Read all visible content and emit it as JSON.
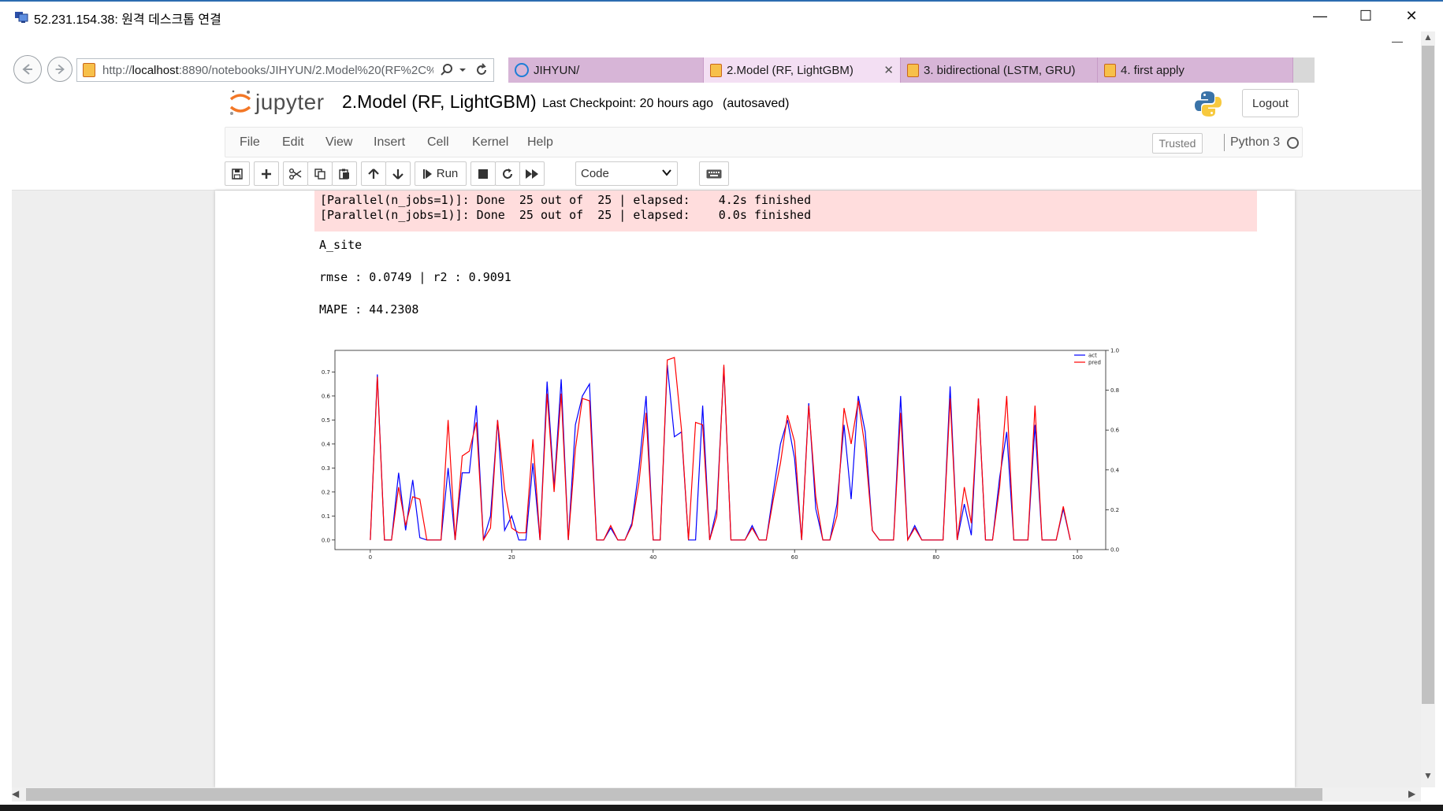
{
  "window": {
    "title": "52.231.154.38: 원격 데스크톱 연결",
    "minimize": "—",
    "maximize": "☐",
    "close": "✕"
  },
  "browser": {
    "url_prefix": "http://",
    "url_host": "localhost",
    "url_rest": ":8890/notebooks/JIHYUN/2.Model%20(RF%2C%",
    "tabs": [
      {
        "label": "JIHYUN/"
      },
      {
        "label": "2.Model (RF, LightGBM)"
      },
      {
        "label": "3. bidirectional (LSTM, GRU)"
      },
      {
        "label": "4. first apply"
      }
    ],
    "tab_close": "✕"
  },
  "jupyter": {
    "logo_text": "jupyter",
    "notebook_title": "2.Model (RF, LightGBM)",
    "checkpoint": "Last Checkpoint: 20 hours ago",
    "autosaved": "(autosaved)",
    "logout": "Logout",
    "menu": [
      "File",
      "Edit",
      "View",
      "Insert",
      "Cell",
      "Kernel",
      "Help"
    ],
    "trusted": "Trusted",
    "kernel": "Python 3",
    "toolbar": {
      "run": "Run",
      "cell_type": "Code"
    }
  },
  "output": {
    "stderr_lines": [
      "[Parallel(n_jobs=1)]: Done  25 out of  25 | elapsed:    4.2s finished",
      "[Parallel(n_jobs=1)]: Done  25 out of  25 | elapsed:    0.0s finished"
    ],
    "site": "A_site",
    "metrics": "rmse : 0.0749 | r2 : 0.9091",
    "mape": "MAPE : 44.2308"
  },
  "chart_data": {
    "type": "line",
    "x": [
      0,
      1,
      2,
      3,
      4,
      5,
      6,
      7,
      8,
      9,
      10,
      11,
      12,
      13,
      14,
      15,
      16,
      17,
      18,
      19,
      20,
      21,
      22,
      23,
      24,
      25,
      26,
      27,
      28,
      29,
      30,
      31,
      32,
      33,
      34,
      35,
      36,
      37,
      38,
      39,
      40,
      41,
      42,
      43,
      44,
      45,
      46,
      47,
      48,
      49,
      50,
      51,
      52,
      53,
      54,
      55,
      56,
      57,
      58,
      59,
      60,
      61,
      62,
      63,
      64,
      65,
      66,
      67,
      68,
      69,
      70,
      71,
      72,
      73,
      74,
      75,
      76,
      77,
      78,
      79,
      80,
      81,
      82,
      83,
      84,
      85,
      86,
      87,
      88,
      89,
      90,
      91,
      92,
      93,
      94,
      95,
      96,
      97,
      98,
      99
    ],
    "series": [
      {
        "name": "act",
        "color": "#0000ff",
        "axis": "left",
        "values": [
          0.0,
          0.69,
          0.0,
          0.0,
          0.28,
          0.04,
          0.25,
          0.01,
          0.0,
          0.0,
          0.0,
          0.3,
          0.0,
          0.28,
          0.28,
          0.56,
          0.0,
          0.1,
          0.5,
          0.04,
          0.1,
          0.0,
          0.0,
          0.32,
          0.0,
          0.66,
          0.22,
          0.67,
          0.0,
          0.48,
          0.6,
          0.65,
          0.0,
          0.0,
          0.05,
          0.0,
          0.0,
          0.07,
          0.3,
          0.6,
          0.0,
          0.0,
          0.73,
          0.43,
          0.45,
          0.0,
          0.0,
          0.56,
          0.0,
          0.13,
          0.72,
          0.0,
          0.0,
          0.0,
          0.06,
          0.0,
          0.0,
          0.2,
          0.4,
          0.5,
          0.34,
          0.0,
          0.57,
          0.13,
          0.0,
          0.0,
          0.15,
          0.48,
          0.17,
          0.6,
          0.45,
          0.04,
          0.0,
          0.0,
          0.0,
          0.6,
          0.0,
          0.06,
          0.0,
          0.0,
          0.0,
          0.0,
          0.64,
          0.0,
          0.15,
          0.02,
          0.59,
          0.0,
          0.0,
          0.26,
          0.45,
          0.0,
          0.0,
          0.0,
          0.48,
          0.0,
          0.0,
          0.0,
          0.13,
          0.0
        ]
      },
      {
        "name": "pred",
        "color": "#ff0000",
        "axis": "left",
        "values": [
          0.0,
          0.68,
          0.0,
          0.0,
          0.22,
          0.06,
          0.18,
          0.17,
          0.0,
          0.0,
          0.0,
          0.5,
          0.0,
          0.35,
          0.37,
          0.49,
          0.0,
          0.05,
          0.5,
          0.21,
          0.05,
          0.03,
          0.03,
          0.42,
          0.0,
          0.61,
          0.2,
          0.61,
          0.0,
          0.38,
          0.59,
          0.58,
          0.0,
          0.0,
          0.06,
          0.0,
          0.0,
          0.06,
          0.24,
          0.53,
          0.0,
          0.0,
          0.75,
          0.76,
          0.46,
          0.0,
          0.49,
          0.48,
          0.0,
          0.1,
          0.73,
          0.0,
          0.0,
          0.0,
          0.05,
          0.0,
          0.0,
          0.17,
          0.32,
          0.52,
          0.41,
          0.0,
          0.56,
          0.18,
          0.0,
          0.0,
          0.1,
          0.55,
          0.4,
          0.58,
          0.38,
          0.04,
          0.0,
          0.0,
          0.0,
          0.53,
          0.0,
          0.05,
          0.0,
          0.0,
          0.0,
          0.0,
          0.59,
          0.0,
          0.22,
          0.07,
          0.59,
          0.0,
          0.0,
          0.22,
          0.6,
          0.0,
          0.0,
          0.0,
          0.56,
          0.0,
          0.0,
          0.0,
          0.14,
          0.0
        ]
      }
    ],
    "ylim": [
      -0.04,
      0.79
    ],
    "y2lim": [
      0.0,
      1.0
    ],
    "xlim": [
      -5,
      104
    ],
    "xticks": [
      0,
      20,
      40,
      60,
      80,
      100
    ],
    "yticks": [
      0.0,
      0.1,
      0.2,
      0.3,
      0.4,
      0.5,
      0.6,
      0.7
    ],
    "y2ticks": [
      0.0,
      0.2,
      0.4,
      0.6,
      0.8,
      1.0
    ],
    "legend": "top-right",
    "grid": false
  }
}
